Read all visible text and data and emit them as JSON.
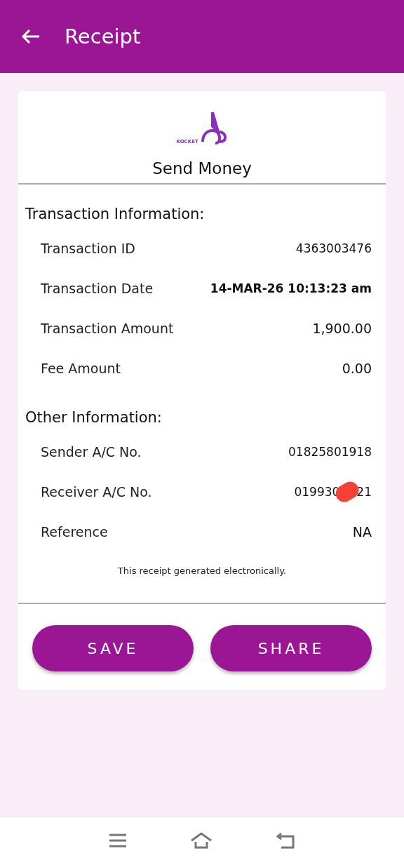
{
  "app_bar": {
    "title": "Receipt"
  },
  "receipt": {
    "logo": {
      "wordmark": "ROCKET"
    },
    "title": "Send Money",
    "sections": [
      {
        "heading": "Transaction Information:",
        "rows": [
          {
            "label": "Transaction ID",
            "value": "4363003476"
          },
          {
            "label": "Transaction Date",
            "value": "14-MAR-26 10:13:23 am"
          },
          {
            "label": "Transaction Amount",
            "value": "1,900.00"
          },
          {
            "label": "Fee Amount",
            "value": "0.00"
          }
        ]
      },
      {
        "heading": "Other Information:",
        "rows": [
          {
            "label": "Sender A/C No.",
            "value": "01825801918"
          },
          {
            "label": "Receiver A/C No.",
            "value": "019930",
            "value_end": "21",
            "redacted": true
          },
          {
            "label": "Reference",
            "value": "NA"
          }
        ]
      }
    ],
    "note": "This receipt generated electronically.",
    "buttons": [
      "SAVE",
      "SHARE"
    ]
  }
}
